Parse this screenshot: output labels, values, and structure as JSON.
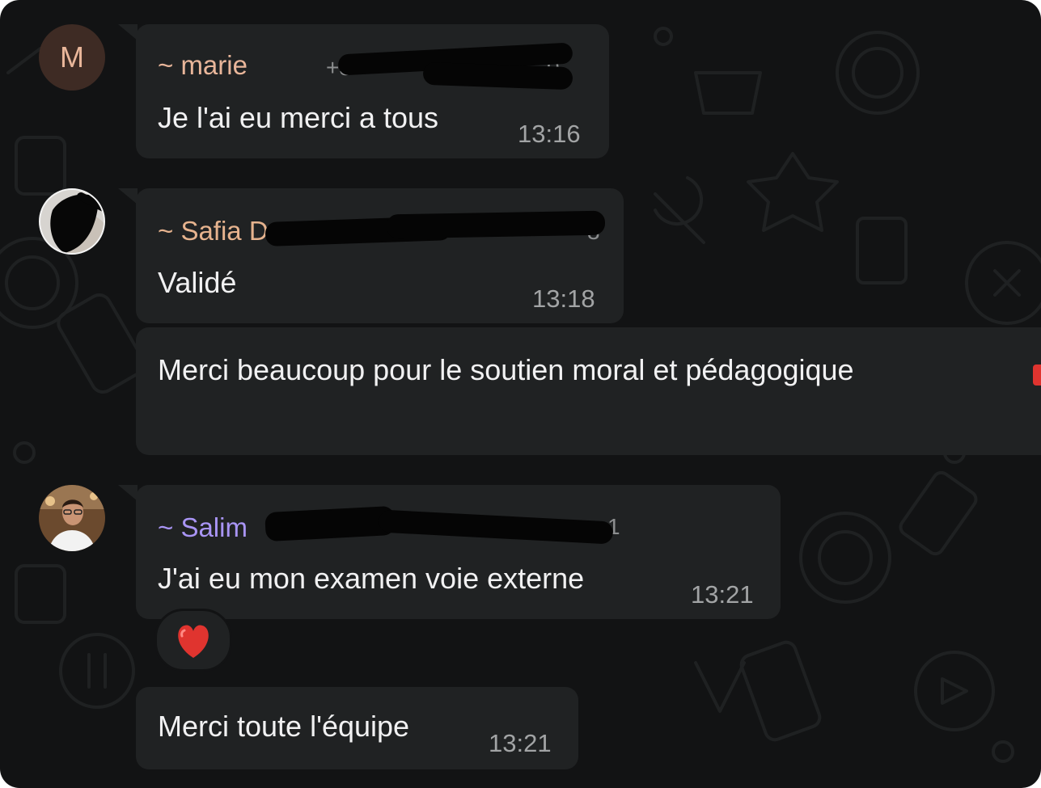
{
  "colors": {
    "background": "#121314",
    "bubble": "#202223",
    "marie_name": "#e9b69a",
    "safia_name": "#e6b38e",
    "salim_name": "#a995f5",
    "message_text": "#f1f1f2",
    "timestamp": "#a2a4a5",
    "heart": "#e0342f"
  },
  "messages": [
    {
      "avatar_letter": "M",
      "sender": "~ marie",
      "phone_fragment": "+3",
      "phone_end": "0",
      "text": "Je l'ai eu merci a tous",
      "time": "13:16"
    },
    {
      "avatar_icon": "contact-photo-redacted",
      "sender": "~ Safia D",
      "phone_end": "3",
      "text": "Validé",
      "time": "13:18"
    },
    {
      "text": "Merci beaucoup pour le soutien moral et  pédagogique"
    },
    {
      "avatar_icon": "contact-photo",
      "sender": "~ Salim",
      "phone_end": "1",
      "text": "J'ai eu mon examen voie externe",
      "time": "13:21",
      "reaction": "❤️"
    },
    {
      "text": "Merci toute l'équipe",
      "time": "13:21"
    }
  ]
}
